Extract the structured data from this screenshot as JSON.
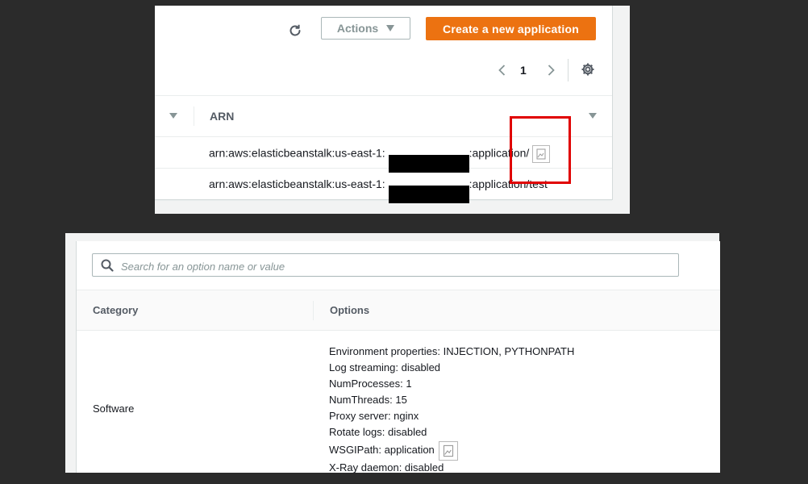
{
  "apps": {
    "actions_label": "Actions",
    "create_label": "Create a new application",
    "page_number": "1",
    "column_header": "ARN",
    "rows": [
      {
        "prefix": "arn:aws:elasticbeanstalk:us-east-1:",
        "suffix": ":application/"
      },
      {
        "prefix": "arn:aws:elasticbeanstalk:us-east-1:",
        "suffix": ":application/test"
      }
    ],
    "accent_color": "#ec7211",
    "highlight_color": "#e00000"
  },
  "config": {
    "search_placeholder": "Search for an option name or value",
    "col_category": "Category",
    "col_options": "Options",
    "category": "Software",
    "options": [
      "Environment properties: INJECTION, PYTHONPATH",
      "Log streaming: disabled",
      "NumProcesses: 1",
      "NumThreads: 15",
      "Proxy server: nginx",
      "Rotate logs: disabled",
      "WSGIPath: application",
      "X-Ray daemon: disabled"
    ]
  }
}
